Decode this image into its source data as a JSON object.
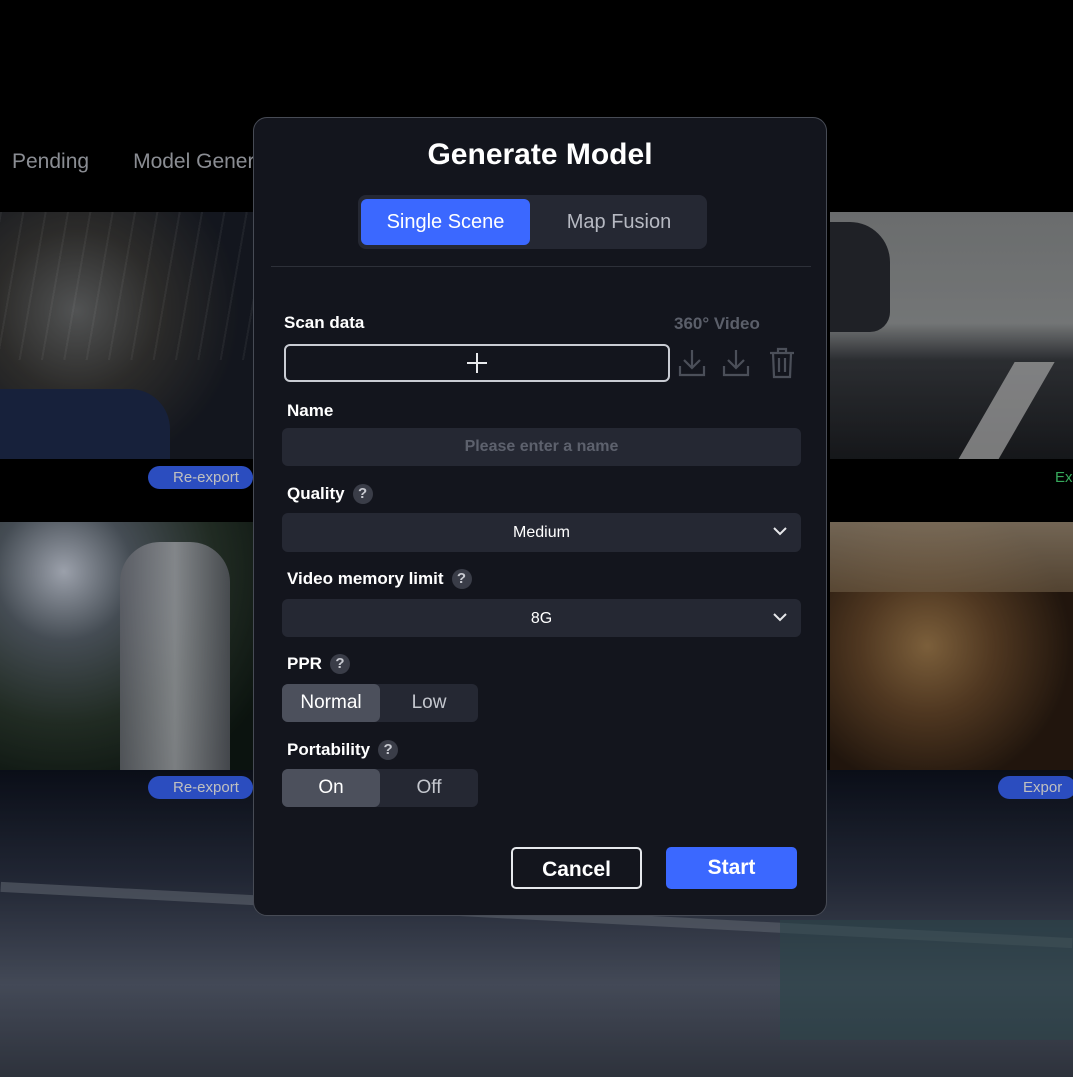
{
  "background": {
    "tabs": [
      "Pending",
      "Model Gener"
    ],
    "badges": [
      "Re-export",
      "Re-export",
      "Exp",
      "Expor"
    ]
  },
  "modal": {
    "title": "Generate Model",
    "mode_tabs": [
      "Single Scene",
      "Map Fusion"
    ],
    "active_mode": "Single Scene",
    "scan_data": {
      "label": "Scan data",
      "source_label": "360° Video"
    },
    "name": {
      "label": "Name",
      "placeholder": "Please enter a name"
    },
    "quality": {
      "label": "Quality",
      "help": "?",
      "value": "Medium"
    },
    "video_memory": {
      "label": "Video memory limit",
      "help": "?",
      "value": "8G"
    },
    "ppr": {
      "label": "PPR",
      "help": "?",
      "options": [
        "Normal",
        "Low"
      ],
      "selected": "Normal"
    },
    "portability": {
      "label": "Portability",
      "help": "?",
      "options": [
        "On",
        "Off"
      ],
      "selected": "On"
    },
    "buttons": {
      "cancel": "Cancel",
      "start": "Start"
    }
  },
  "colors": {
    "accent": "#3b68ff",
    "dialog_bg": "#13151d",
    "field_bg": "#252833",
    "export_green": "#48e07a"
  },
  "icons": [
    "plus-icon",
    "download-icon",
    "download-icon",
    "trash-icon",
    "help-icon",
    "chevron-down-icon"
  ]
}
